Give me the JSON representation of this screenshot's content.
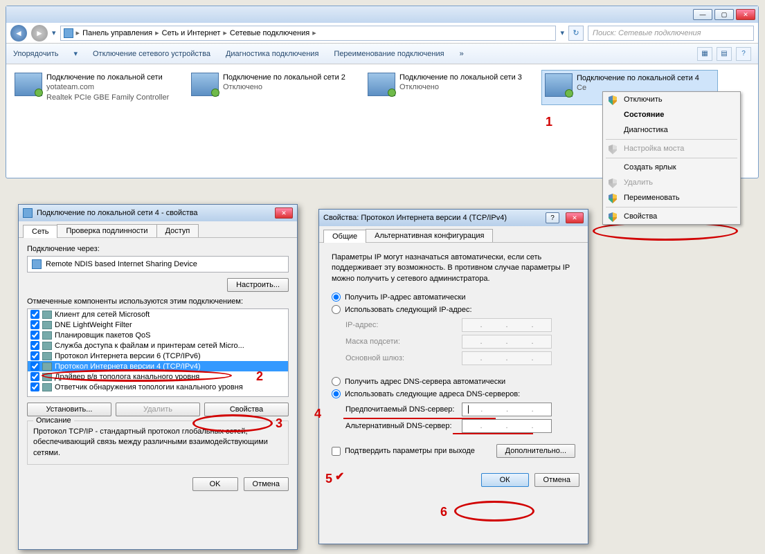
{
  "explorer": {
    "breadcrumbs": [
      "Панель управления",
      "Сеть и Интернет",
      "Сетевые подключения"
    ],
    "search_placeholder": "Поиск: Сетевые подключения",
    "toolbar": {
      "organize": "Упорядочить",
      "disable": "Отключение сетевого устройства",
      "diagnose": "Диагностика подключения",
      "rename": "Переименование подключения",
      "more": "»"
    },
    "connections": [
      {
        "title": "Подключение по локальной сети",
        "line2": "yotateam.com",
        "line3": "Realtek PCIe GBE Family Controller"
      },
      {
        "title": "Подключение по локальной сети 2",
        "line2": "Отключено",
        "line3": ""
      },
      {
        "title": "Подключение по локальной сети 3",
        "line2": "Отключено",
        "line3": ""
      },
      {
        "title": "Подключение по локальной сети 4",
        "line2": "Се",
        "line3": ""
      }
    ]
  },
  "context_menu": {
    "items": [
      {
        "label": "Отключить",
        "shield": true
      },
      {
        "label": "Состояние",
        "bold": true
      },
      {
        "label": "Диагностика"
      },
      {
        "sep": true
      },
      {
        "label": "Настройка моста",
        "shield": true,
        "disabled": true
      },
      {
        "sep": true
      },
      {
        "label": "Создать ярлык"
      },
      {
        "label": "Удалить",
        "shield": true,
        "disabled": true
      },
      {
        "label": "Переименовать",
        "shield": true
      },
      {
        "sep": true
      },
      {
        "label": "Свойства",
        "shield": true
      }
    ]
  },
  "dlg1": {
    "title": "Подключение по локальной сети 4 - свойства",
    "tabs": [
      "Сеть",
      "Проверка подлинности",
      "Доступ"
    ],
    "connect_via_label": "Подключение через:",
    "adapter": "Remote NDIS based Internet Sharing Device",
    "configure_btn": "Настроить...",
    "components_label": "Отмеченные компоненты используются этим подключением:",
    "components": [
      "Клиент для сетей Microsoft",
      "DNE LightWeight Filter",
      "Планировщик пакетов QoS",
      "Служба доступа к файлам и принтерам сетей Micro...",
      "Протокол Интернета версии 6 (TCP/IPv6)",
      "Протокол Интернета версии 4 (TCP/IPv4)",
      "Драйвер в/в тополога канального уровня",
      "Ответчик обнаружения топологии канального уровня"
    ],
    "install_btn": "Установить...",
    "uninstall_btn": "Удалить",
    "properties_btn": "Свойства",
    "desc_title": "Описание",
    "desc_text": "Протокол TCP/IP - стандартный протокол глобальных сетей, обеспечивающий связь между различными взаимодействующими сетями.",
    "ok": "OK",
    "cancel": "Отмена"
  },
  "dlg2": {
    "title": "Свойства: Протокол Интернета версии 4 (TCP/IPv4)",
    "tabs": [
      "Общие",
      "Альтернативная конфигурация"
    ],
    "intro": "Параметры IP могут назначаться автоматически, если сеть поддерживает эту возможность. В противном случае параметры IP можно получить у сетевого администратора.",
    "radio_ip_auto": "Получить IP-адрес автоматически",
    "radio_ip_manual": "Использовать следующий IP-адрес:",
    "ip_label": "IP-адрес:",
    "mask_label": "Маска подсети:",
    "gw_label": "Основной шлюз:",
    "radio_dns_auto": "Получить адрес DNS-сервера автоматически",
    "radio_dns_manual": "Использовать следующие адреса DNS-серверов:",
    "dns1_label": "Предпочитаемый DNS-сервер:",
    "dns2_label": "Альтернативный DNS-сервер:",
    "confirm_chk": "Подтвердить параметры при выходе",
    "advanced_btn": "Дополнительно...",
    "ok": "ОК",
    "cancel": "Отмена"
  },
  "annotations": {
    "n1": "1",
    "n2": "2",
    "n3": "3",
    "n4": "4",
    "n5": "5",
    "n6": "6"
  }
}
